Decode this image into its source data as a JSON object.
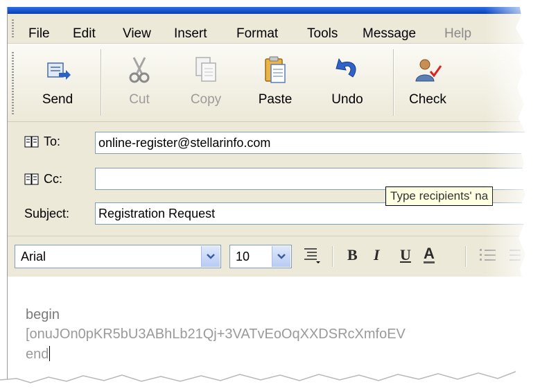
{
  "menu": {
    "items": [
      {
        "label": "File"
      },
      {
        "label": "Edit"
      },
      {
        "label": "View"
      },
      {
        "label": "Insert"
      },
      {
        "label": "Format"
      },
      {
        "label": "Tools"
      },
      {
        "label": "Message"
      },
      {
        "label": "Help"
      }
    ]
  },
  "toolbar": {
    "send": {
      "label": "Send",
      "icon": "send-icon"
    },
    "cut": {
      "label": "Cut",
      "icon": "scissors-icon"
    },
    "copy": {
      "label": "Copy",
      "icon": "copy-icon"
    },
    "paste": {
      "label": "Paste",
      "icon": "clipboard-icon"
    },
    "undo": {
      "label": "Undo",
      "icon": "undo-arrow-icon"
    },
    "check": {
      "label": "Check",
      "icon": "check-names-icon"
    }
  },
  "header": {
    "to": {
      "label": "To:",
      "value": "online-register@stellarinfo.com"
    },
    "cc": {
      "label": "Cc:",
      "value": ""
    },
    "subject": {
      "label": "Subject:",
      "value": "Registration Request"
    },
    "tooltip": "Type recipients' na"
  },
  "format": {
    "font": "Arial",
    "size": "10",
    "bold": "B",
    "italic": "I",
    "underline": "U",
    "font_color": "A"
  },
  "body": {
    "lines": [
      "begin",
      "[onuJOn0pKR5bU3ABhLb21Qj+3VATvEoOqXXDSRcXmfoEV",
      "end"
    ]
  },
  "colors": {
    "titlebar": "#0a3fb3",
    "chrome": "#ece9d8",
    "input_border": "#7f9db9",
    "tooltip_bg": "#ffffe1"
  }
}
